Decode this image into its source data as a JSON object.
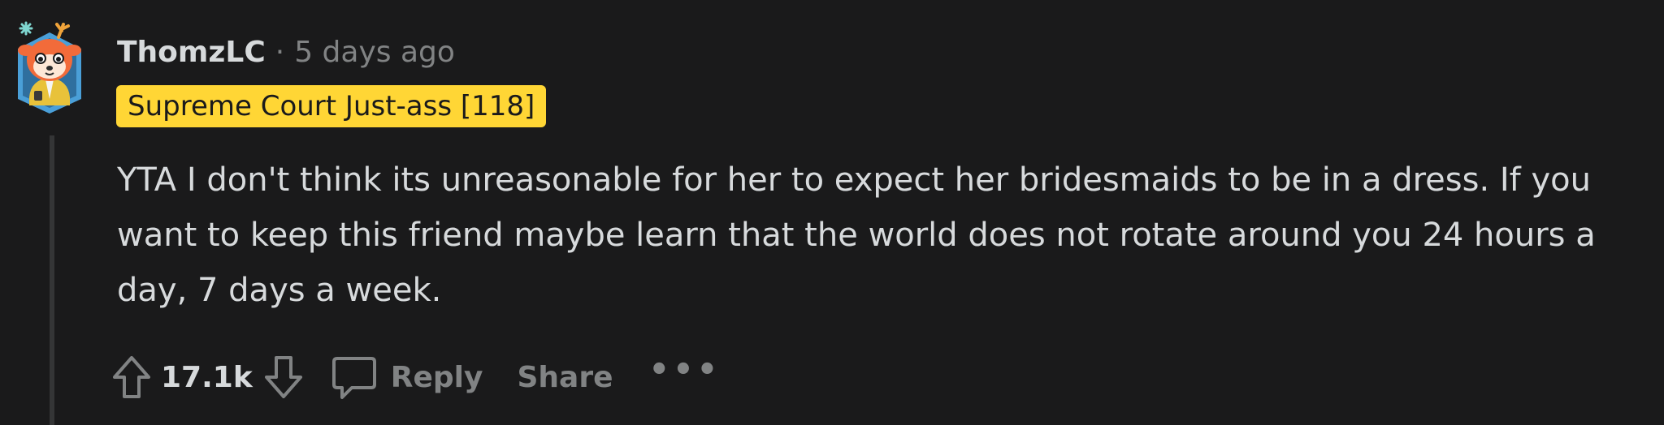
{
  "comment": {
    "author": "ThomzLC",
    "separator": "·",
    "time_ago": "5 days ago",
    "flair": "Supreme Court Just-ass [118]",
    "body": "YTA I don't think its unreasonable for her to expect her bridesmaids to be in a dress. If you want to keep this friend maybe learn that the world does not rotate around you 24 hours a day, 7 days a week.",
    "score": "17.1k",
    "reply_label": "Reply",
    "share_label": "Share",
    "more_label": "•••"
  },
  "colors": {
    "background": "#1a1a1b",
    "text_primary": "#d7dadc",
    "text_muted": "#818384",
    "flair_bg": "#ffd635",
    "avatar_badge": "#4a9fd8",
    "avatar_face": "#f26b3a"
  },
  "icons": {
    "avatar": "deer-avatar-icon",
    "upvote": "upvote-arrow-icon",
    "downvote": "downvote-arrow-icon",
    "reply": "speech-bubble-icon",
    "more": "more-dots-icon"
  }
}
